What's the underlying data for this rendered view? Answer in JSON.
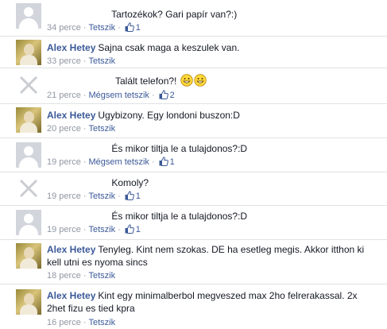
{
  "comments": [
    {
      "author": "",
      "text": "Tartozékok? Gari papír van?:)",
      "time": "34 perce",
      "like": "Tetszik",
      "count": "1"
    },
    {
      "author": "Alex Hetey",
      "text": "Sajna csak maga a keszulek van.",
      "time": "33 perce",
      "like": "Tetszik",
      "count": ""
    },
    {
      "author": "",
      "text": "Talált telefon?!",
      "time": "21 perce",
      "like": "Mégsem tetszik",
      "count": "2"
    },
    {
      "author": "Alex Hetey",
      "text": "Ugybizony. Egy londoni buszon:D",
      "time": "20 perce",
      "like": "Tetszik",
      "count": ""
    },
    {
      "author": "",
      "text": "És mikor tiltja le a tulajdonos?:D",
      "time": "19 perce",
      "like": "Mégsem tetszik",
      "count": "1"
    },
    {
      "author": "",
      "text": "Komoly?",
      "time": "19 perce",
      "like": "Tetszik",
      "count": "1"
    },
    {
      "author": "",
      "text": "És mikor tiltja le a tulajdonos?:D",
      "time": "19 perce",
      "like": "Tetszik",
      "count": "1"
    },
    {
      "author": "Alex Hetey",
      "text": "Tenyleg. Kint nem szokas. DE ha esetleg megis. Akkor itthon ki kell utni es nyoma sincs",
      "time": "18 perce",
      "like": "Tetszik",
      "count": ""
    },
    {
      "author": "Alex Hetey",
      "text": "Kint egy minimalberbol megveszed max 2ho felrerakassal. 2x 2het fizu es tied kpra",
      "time": "16 perce",
      "like": "Tetszik",
      "count": ""
    }
  ],
  "icons": {
    "like": "thumbs-up-icon",
    "emoji": "grinning-face-icon",
    "avatar_default": "default-avatar-icon",
    "avatar_broken": "broken-image-icon"
  },
  "colors": {
    "link": "#3b5998",
    "meta": "#9197a3",
    "divider": "#e1e2e3"
  }
}
